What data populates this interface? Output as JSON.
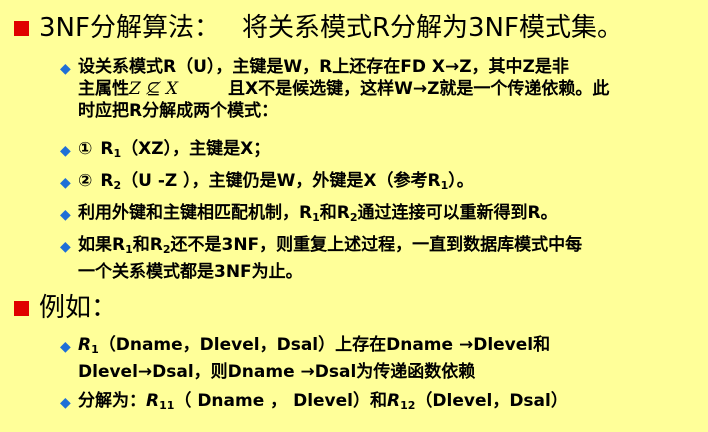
{
  "heading1": {
    "text": "3NF分解算法：",
    "text2": "将关系模式R分解为3NF模式集。"
  },
  "items1": [
    {
      "line1": "设关系模式R（U），主键是W，R上还存在FD X→Z，其中Z是非",
      "line2a": "主属性",
      "line2_math": "Z ⊈ X",
      "line2b": "且X不是候选键，这样W→Z就是一个传递依赖。此",
      "line3": "时应把R分解成两个模式："
    },
    {
      "num": "①",
      "r": "R",
      "sub": "1",
      "rest": "（XZ），主键是X；"
    },
    {
      "num": "②",
      "r": "R",
      "sub": "2",
      "rest": "（U -Z ），主键仍是W，外键是X（参考R",
      "sub2": "1",
      "end": "）。"
    },
    {
      "pre": "利用外键和主键相匹配机制，R",
      "sub1": "1",
      "mid": "和R",
      "sub2": "2",
      "post": "通过连接可以重新得到R。"
    },
    {
      "pre": "如果R",
      "sub1": "1",
      "mid": "和R",
      "sub2": "2",
      "post": "还不是3NF，则重复上述过程，一直到数据库模式中每",
      "line2": "一个关系模式都是3NF为止。"
    }
  ],
  "heading2": {
    "text": "例如："
  },
  "items2": [
    {
      "r": "R",
      "sub": "1",
      "post": "（Dname，Dlevel，Dsal）上存在Dname →Dlevel和",
      "line2": "Dlevel→Dsal，则Dname →Dsal为传递函数依赖"
    },
    {
      "pre": "分解为：",
      "r1": "R",
      "sub1": "11",
      "mid": "（ Dname ， Dlevel）和",
      "r2": "R",
      "sub2": "12",
      "post": "（Dlevel，Dsal）"
    }
  ],
  "colors": {
    "background": "#ffff99",
    "bullet_square": "#e00000",
    "bullet_diamond": "#1f6fd6"
  }
}
